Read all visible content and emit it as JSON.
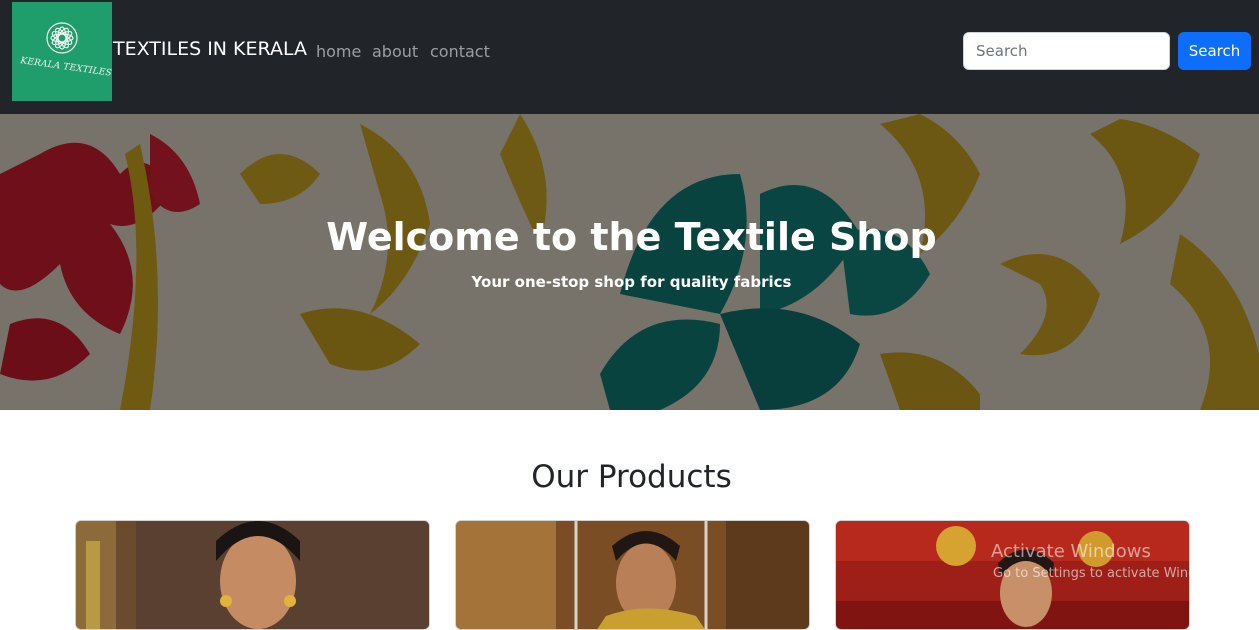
{
  "navbar": {
    "logo_text": "KERALA TEXTILES",
    "brand": "TEXTILES IN KERALA",
    "links": [
      {
        "label": "home"
      },
      {
        "label": "about"
      },
      {
        "label": "contact"
      }
    ],
    "search": {
      "placeholder": "Search",
      "button_label": "Search"
    }
  },
  "hero": {
    "title": "Welcome to the Textile Shop",
    "subtitle": "Your one-stop shop for quality fabrics"
  },
  "products": {
    "title": "Our Products"
  },
  "watermark": {
    "line1": "Activate Windows",
    "line2": "Go to Settings to activate Windows."
  },
  "colors": {
    "navbar_bg": "#212529",
    "logo_bg": "#1f9d6b",
    "search_button": "#0d6efd"
  }
}
